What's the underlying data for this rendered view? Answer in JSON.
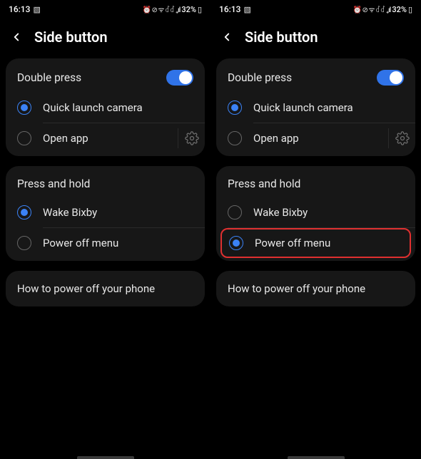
{
  "status": {
    "time": "16:13",
    "battery": "32%",
    "icons": "⏰ ⊘ ᯤ ꒬꒬ ₊ıl"
  },
  "header": {
    "title": "Side button"
  },
  "double_press": {
    "title": "Double press",
    "toggle_on": true,
    "opt1": "Quick launch camera",
    "opt2": "Open app"
  },
  "press_hold": {
    "title": "Press and hold",
    "opt1": "Wake Bixby",
    "opt2": "Power off menu"
  },
  "howto": {
    "label": "How to power off your phone"
  },
  "left_screen": {
    "press_hold_selected": "opt1"
  },
  "right_screen": {
    "press_hold_selected": "opt2",
    "highlight_opt2": true
  }
}
